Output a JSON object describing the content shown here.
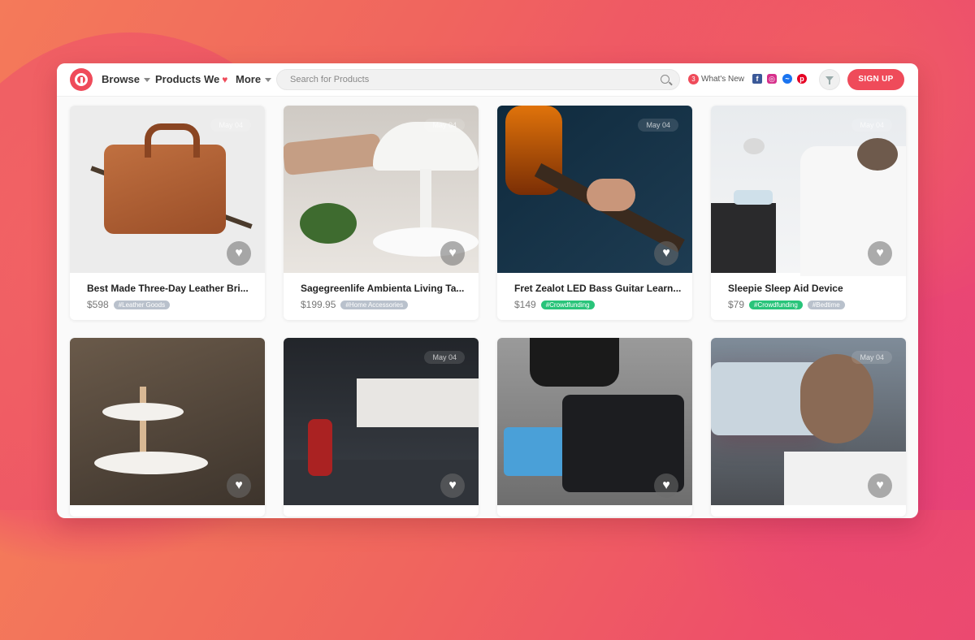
{
  "nav": {
    "browse": "Browse",
    "products_we": "Products We",
    "more": "More",
    "search_placeholder": "Search for Products",
    "whats_new_count": "3",
    "whats_new": "What's New",
    "signup": "SIGN UP"
  },
  "social": [
    "facebook-icon",
    "instagram-icon",
    "messenger-icon",
    "pinterest-icon"
  ],
  "colors": {
    "accent": "#ef4b5a",
    "tag_green": "#29c47a",
    "tag_grey": "#b9c1cc"
  },
  "cards": [
    {
      "date": "May 04",
      "title": "Best Made Three-Day Leather Bri...",
      "price": "$598",
      "tags": [
        {
          "text": "#Leather Goods",
          "green": false
        }
      ]
    },
    {
      "date": "May 04",
      "title": "Sagegreenlife Ambienta Living Ta...",
      "price": "$199.95",
      "tags": [
        {
          "text": "#Home Accessories",
          "green": false
        }
      ]
    },
    {
      "date": "May 04",
      "title": "Fret Zealot LED Bass Guitar Learn...",
      "price": "$149",
      "tags": [
        {
          "text": "#Crowdfunding",
          "green": true
        }
      ]
    },
    {
      "date": "May 04",
      "title": "Sleepie Sleep Aid Device",
      "price": "$79",
      "tags": [
        {
          "text": "#Crowdfunding",
          "green": true
        },
        {
          "text": "#Bedtime",
          "green": false
        }
      ]
    },
    {
      "date": ""
    },
    {
      "date": "May 04"
    },
    {
      "date": ""
    },
    {
      "date": "May 04"
    }
  ]
}
